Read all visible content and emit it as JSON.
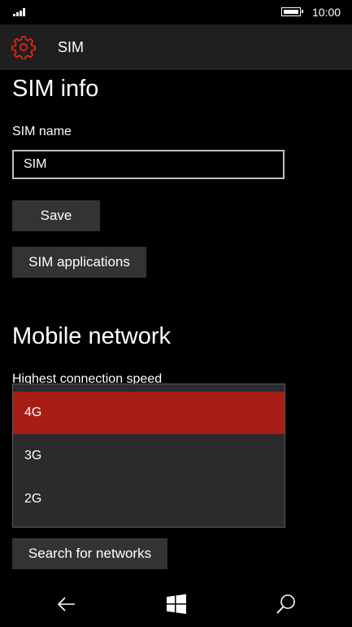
{
  "status_bar": {
    "time": "10:00",
    "signal_icon": "signal-icon",
    "battery_icon": "battery-icon"
  },
  "header": {
    "icon": "gear-icon",
    "title": "SIM"
  },
  "sim_info": {
    "title": "SIM info",
    "name_label": "SIM name",
    "name_value": "SIM",
    "save_label": "Save",
    "apps_label": "SIM applications"
  },
  "mobile_network": {
    "title": "Mobile network",
    "speed_label": "Highest connection speed",
    "options": [
      "4G",
      "3G",
      "2G"
    ],
    "selected": "4G",
    "search_label": "Search for networks"
  },
  "nav": {
    "back_icon": "back-icon",
    "start_icon": "windows-icon",
    "search_icon": "search-icon"
  },
  "colors": {
    "accent": "#a71d15",
    "header_bg": "#1f1f1f",
    "button_bg": "#333333",
    "gear": "#e0241b"
  }
}
